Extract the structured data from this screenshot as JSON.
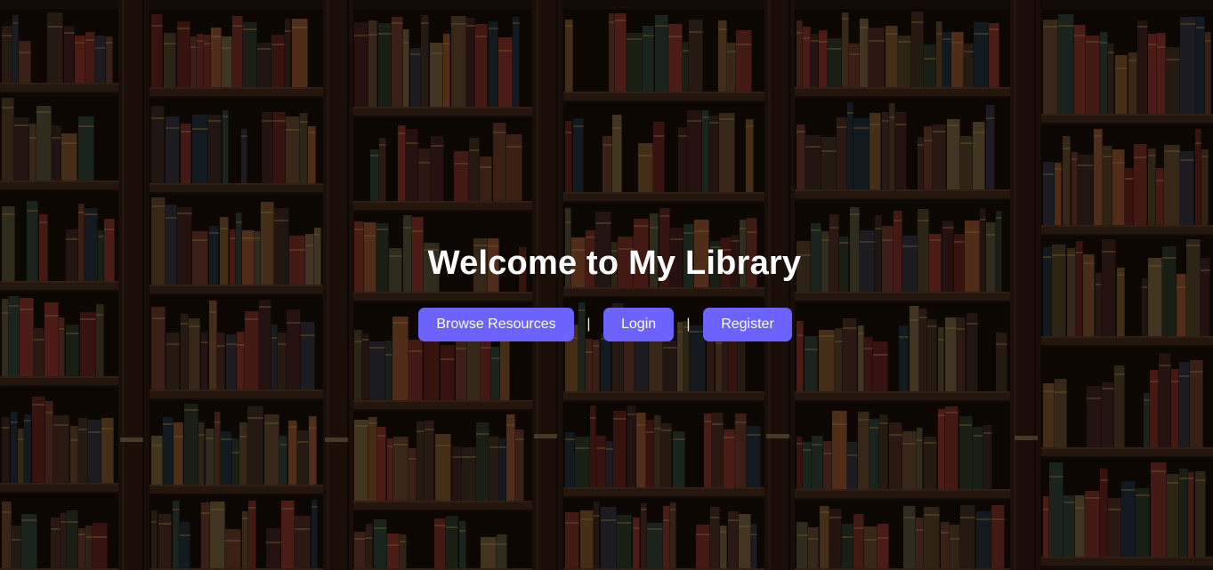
{
  "hero": {
    "title": "Welcome to My Library"
  },
  "nav": {
    "items": [
      {
        "label": "Browse Resources",
        "name": "browse-resources-button"
      },
      {
        "label": "Login",
        "name": "login-button"
      },
      {
        "label": "Register",
        "name": "register-button"
      }
    ],
    "separator": "|"
  },
  "colors": {
    "button_bg": "#6c63ff",
    "button_text": "#ffffff",
    "title_text": "#ffffff",
    "shelf_wood": "#2e1b12"
  },
  "background": {
    "subject": "bookshelf"
  }
}
